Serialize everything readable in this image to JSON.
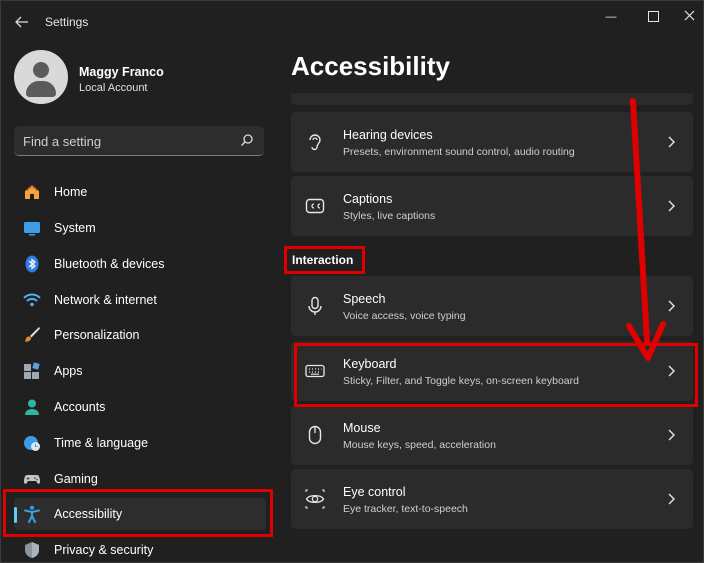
{
  "window": {
    "title": "Settings",
    "controls": {
      "minimize": "—"
    }
  },
  "profile": {
    "name": "Maggy Franco",
    "account_type": "Local Account"
  },
  "search": {
    "placeholder": "Find a setting"
  },
  "nav": {
    "items": [
      {
        "label": "Home",
        "icon": "home-icon"
      },
      {
        "label": "System",
        "icon": "system-icon"
      },
      {
        "label": "Bluetooth & devices",
        "icon": "bluetooth-icon"
      },
      {
        "label": "Network & internet",
        "icon": "wifi-icon"
      },
      {
        "label": "Personalization",
        "icon": "brush-icon"
      },
      {
        "label": "Apps",
        "icon": "apps-icon"
      },
      {
        "label": "Accounts",
        "icon": "accounts-icon"
      },
      {
        "label": "Time & language",
        "icon": "time-language-icon"
      },
      {
        "label": "Gaming",
        "icon": "gamepad-icon"
      },
      {
        "label": "Accessibility",
        "icon": "accessibility-icon",
        "selected": true
      },
      {
        "label": "Privacy & security",
        "icon": "shield-icon"
      }
    ]
  },
  "main": {
    "title": "Accessibility",
    "cards_top": [
      {
        "title": "Hearing devices",
        "subtitle": "Presets, environment sound control, audio routing",
        "icon": "hearing-icon"
      },
      {
        "title": "Captions",
        "subtitle": "Styles, live captions",
        "icon": "captions-icon"
      }
    ],
    "section_label": "Interaction",
    "cards_interaction": [
      {
        "title": "Speech",
        "subtitle": "Voice access, voice typing",
        "icon": "microphone-icon"
      },
      {
        "title": "Keyboard",
        "subtitle": "Sticky, Filter, and Toggle keys, on-screen keyboard",
        "icon": "keyboard-icon"
      },
      {
        "title": "Mouse",
        "subtitle": "Mouse keys, speed, acceleration",
        "icon": "mouse-icon"
      },
      {
        "title": "Eye control",
        "subtitle": "Eye tracker, text-to-speech",
        "icon": "eye-icon"
      }
    ]
  },
  "colors": {
    "accent": "#60cdff",
    "highlight": "#e00000",
    "background": "#202020",
    "card": "#2b2b2b"
  }
}
